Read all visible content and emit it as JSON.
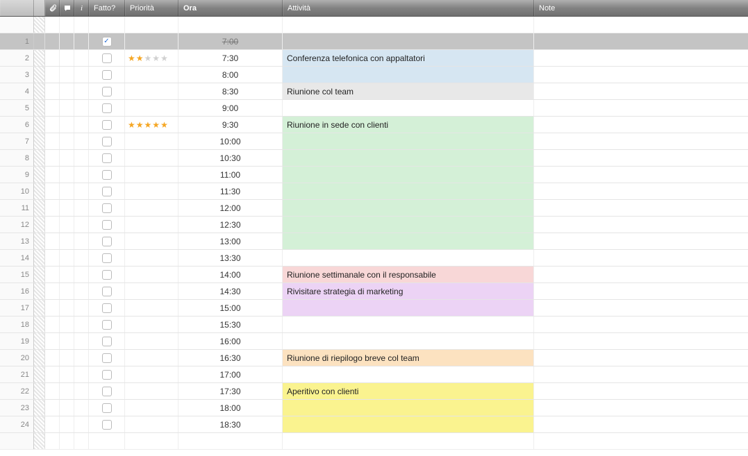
{
  "headers": {
    "attach_icon": "paperclip-icon",
    "comment_icon": "comment-icon",
    "info": "i",
    "done": "Fatto?",
    "priority": "Priorità",
    "time": "Ora",
    "activity": "Attività",
    "note": "Note"
  },
  "rows": [
    {
      "num": 1,
      "done": true,
      "stars": 0,
      "time": "7:00",
      "activity": "",
      "bg": "",
      "selected": true
    },
    {
      "num": 2,
      "done": false,
      "stars": 2,
      "time": "7:30",
      "activity": "Conferenza telefonica con appaltatori",
      "bg": "blue"
    },
    {
      "num": 3,
      "done": false,
      "stars": 0,
      "time": "8:00",
      "activity": "",
      "bg": "blue"
    },
    {
      "num": 4,
      "done": false,
      "stars": 0,
      "time": "8:30",
      "activity": "Riunione col team",
      "bg": "grey"
    },
    {
      "num": 5,
      "done": false,
      "stars": 0,
      "time": "9:00",
      "activity": "",
      "bg": ""
    },
    {
      "num": 6,
      "done": false,
      "stars": 5,
      "time": "9:30",
      "activity": "Riunione in sede con clienti",
      "bg": "green"
    },
    {
      "num": 7,
      "done": false,
      "stars": 0,
      "time": "10:00",
      "activity": "",
      "bg": "green"
    },
    {
      "num": 8,
      "done": false,
      "stars": 0,
      "time": "10:30",
      "activity": "",
      "bg": "green"
    },
    {
      "num": 9,
      "done": false,
      "stars": 0,
      "time": "11:00",
      "activity": "",
      "bg": "green"
    },
    {
      "num": 10,
      "done": false,
      "stars": 0,
      "time": "11:30",
      "activity": "",
      "bg": "green"
    },
    {
      "num": 11,
      "done": false,
      "stars": 0,
      "time": "12:00",
      "activity": "",
      "bg": "green"
    },
    {
      "num": 12,
      "done": false,
      "stars": 0,
      "time": "12:30",
      "activity": "",
      "bg": "green"
    },
    {
      "num": 13,
      "done": false,
      "stars": 0,
      "time": "13:00",
      "activity": "",
      "bg": "green"
    },
    {
      "num": 14,
      "done": false,
      "stars": 0,
      "time": "13:30",
      "activity": "",
      "bg": ""
    },
    {
      "num": 15,
      "done": false,
      "stars": 0,
      "time": "14:00",
      "activity": "Riunione settimanale con il responsabile",
      "bg": "pink"
    },
    {
      "num": 16,
      "done": false,
      "stars": 0,
      "time": "14:30",
      "activity": "Rivisitare strategia di marketing",
      "bg": "purple"
    },
    {
      "num": 17,
      "done": false,
      "stars": 0,
      "time": "15:00",
      "activity": "",
      "bg": "purple"
    },
    {
      "num": 18,
      "done": false,
      "stars": 0,
      "time": "15:30",
      "activity": "",
      "bg": ""
    },
    {
      "num": 19,
      "done": false,
      "stars": 0,
      "time": "16:00",
      "activity": "",
      "bg": ""
    },
    {
      "num": 20,
      "done": false,
      "stars": 0,
      "time": "16:30",
      "activity": "Riunione di riepilogo breve col team",
      "bg": "orange"
    },
    {
      "num": 21,
      "done": false,
      "stars": 0,
      "time": "17:00",
      "activity": "",
      "bg": ""
    },
    {
      "num": 22,
      "done": false,
      "stars": 0,
      "time": "17:30",
      "activity": "Aperitivo con clienti",
      "bg": "yellow"
    },
    {
      "num": 23,
      "done": false,
      "stars": 0,
      "time": "18:00",
      "activity": "",
      "bg": "yellow"
    },
    {
      "num": 24,
      "done": false,
      "stars": 0,
      "time": "18:30",
      "activity": "",
      "bg": "yellow"
    }
  ],
  "filler_rows": 2
}
